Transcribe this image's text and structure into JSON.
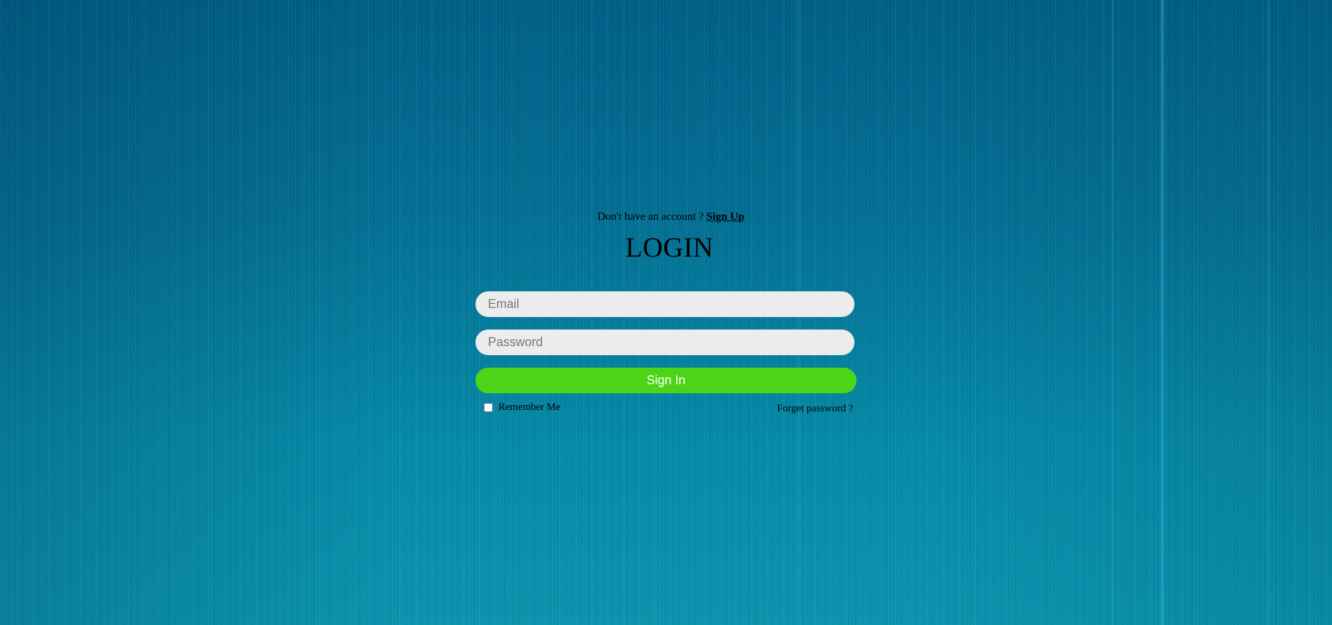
{
  "header": {
    "signup_prompt": "Don't have an account ?",
    "signup_link": "Sign Up"
  },
  "login": {
    "title": "LOGIN",
    "email": {
      "placeholder": "Email",
      "value": ""
    },
    "password": {
      "placeholder": "Password",
      "value": ""
    },
    "signin_label": "Sign In",
    "remember_label": "Remember Me",
    "remember_checked": false,
    "forget_label": "Forget password ?"
  },
  "colors": {
    "background": "#0580a0",
    "signin_button": "#4cd516",
    "input_background": "#ececec",
    "text": "#000000"
  }
}
